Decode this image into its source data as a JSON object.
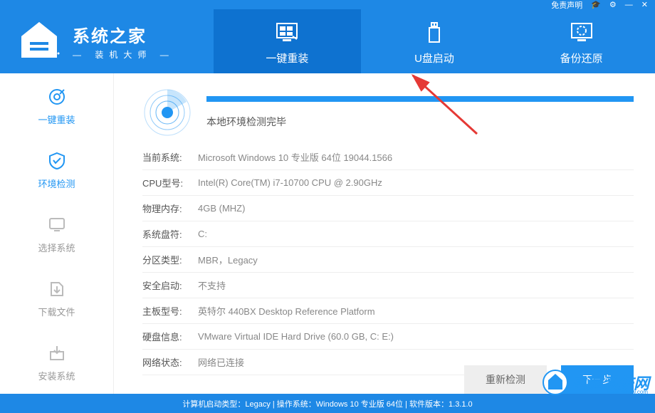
{
  "titlebar": {
    "disclaimer": "免责声明",
    "minimize": "—",
    "close": "✕"
  },
  "logo": {
    "title": "系统之家",
    "subtitle": "装机大师"
  },
  "nav": [
    {
      "label": "一键重装",
      "active": true
    },
    {
      "label": "U盘启动",
      "active": false
    },
    {
      "label": "备份还原",
      "active": false
    }
  ],
  "sidebar": [
    {
      "label": "一键重装",
      "current": true
    },
    {
      "label": "环境检测",
      "current": false
    },
    {
      "label": "选择系统",
      "current": false
    },
    {
      "label": "下载文件",
      "current": false
    },
    {
      "label": "安装系统",
      "current": false
    }
  ],
  "scan": {
    "status": "本地环境检测完毕"
  },
  "info": [
    {
      "label": "当前系统:",
      "value": "Microsoft Windows 10 专业版 64位 19044.1566"
    },
    {
      "label": "CPU型号:",
      "value": "Intel(R) Core(TM) i7-10700 CPU @ 2.90GHz"
    },
    {
      "label": "物理内存:",
      "value": "4GB (MHZ)"
    },
    {
      "label": "系统盘符:",
      "value": "C:"
    },
    {
      "label": "分区类型:",
      "value": "MBR，Legacy"
    },
    {
      "label": "安全启动:",
      "value": "不支持"
    },
    {
      "label": "主板型号:",
      "value": "英特尔 440BX Desktop Reference Platform"
    },
    {
      "label": "硬盘信息:",
      "value": "VMware Virtual IDE Hard Drive  (60.0 GB, C: E:)"
    },
    {
      "label": "网络状态:",
      "value": "网络已连接"
    }
  ],
  "buttons": {
    "recheck": "重新检测",
    "next": "下一步"
  },
  "footer": "计算机启动类型：Legacy | 操作系统：Windows 10 专业版 64位 | 软件版本：1.3.1.0",
  "watermark": {
    "text": "电脑系统网",
    "url": "www.dnxtw.com"
  }
}
